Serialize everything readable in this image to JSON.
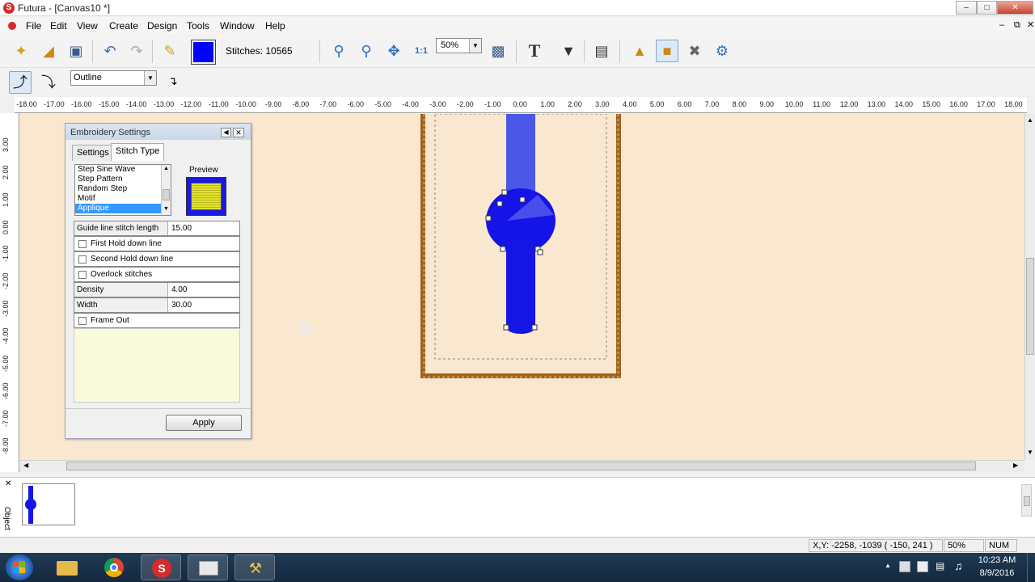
{
  "window": {
    "title": "Futura - [Canvas10 *]"
  },
  "menu": [
    "File",
    "Edit",
    "View",
    "Create",
    "Design",
    "Tools",
    "Window",
    "Help"
  ],
  "toolbar": {
    "stitches_label": "Stitches: 10565",
    "current_color": "#0000ff",
    "zoom_value": "50%"
  },
  "toolbar2": {
    "mode_value": "Outline"
  },
  "ruler": {
    "h_labels": [
      "-18.00",
      "-17.00",
      "-16.00",
      "-15.00",
      "-14.00",
      "-13.00",
      "-12.00",
      "-11.00",
      "-10.00",
      "-9.00",
      "-8.00",
      "-7.00",
      "-6.00",
      "-5.00",
      "-4.00",
      "-3.00",
      "-2.00",
      "-1.00",
      "0.00",
      "1.00",
      "2.00",
      "3.00",
      "4.00",
      "5.00",
      "6.00",
      "7.00",
      "8.00",
      "9.00",
      "10.00",
      "11.00",
      "12.00",
      "13.00",
      "14.00",
      "15.00",
      "16.00",
      "17.00",
      "18.00"
    ],
    "v_labels": [
      "3.00",
      "2.00",
      "1.00",
      "0.00",
      "-1.00",
      "-2.00",
      "-3.00",
      "-4.00",
      "-5.00",
      "-6.00",
      "-7.00",
      "-8.00"
    ]
  },
  "dialog": {
    "title": "Embroidery Settings",
    "tabs": [
      "Settings",
      "Stitch Type"
    ],
    "stitch_types": [
      "Step Sine Wave",
      "Step Pattern",
      "Random Step",
      "Motif",
      "Applique"
    ],
    "preview_label": "Preview",
    "props": {
      "guide_label": "Guide line stitch length",
      "guide_value": "15.00",
      "first_hold": "First Hold down line",
      "second_hold": "Second Hold down line",
      "overlock": "Overlock stitches",
      "density_label": "Density",
      "density_value": "4.00",
      "width_label": "Width",
      "width_value": "30.00",
      "frame_out": "Frame Out"
    },
    "apply_label": "Apply"
  },
  "objects_panel": {
    "label": "Object"
  },
  "status": {
    "xy": "X,Y: -2258, -1039  ( -150, 241 )",
    "zoom": "50%",
    "num": "NUM"
  },
  "taskbar": {
    "time": "10:23 AM",
    "date": "8/9/2016"
  },
  "colors": {
    "accent": "#0000ff",
    "canvas": "#f9e7cf",
    "hoop": "#a0621f"
  }
}
